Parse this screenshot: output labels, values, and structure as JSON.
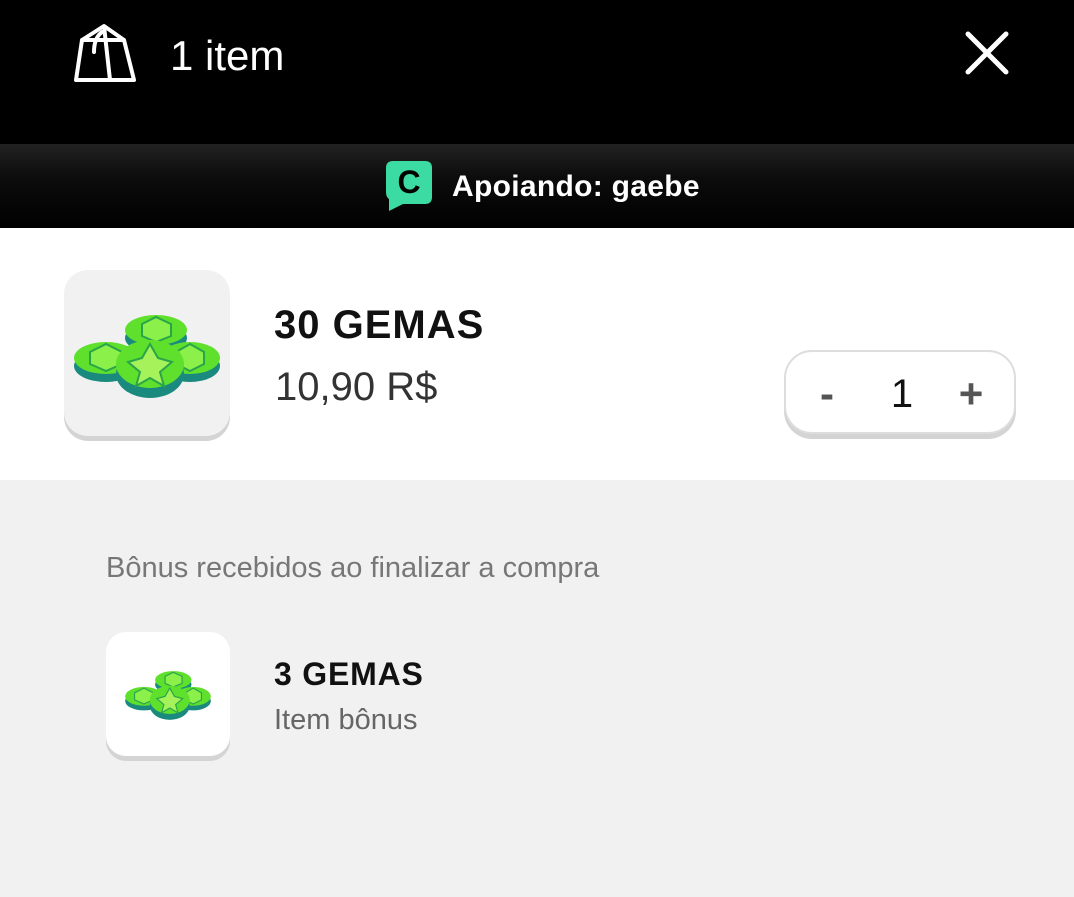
{
  "header": {
    "item_count": "1 item",
    "bag_icon": "shopping-bag-icon",
    "close_icon": "close-icon"
  },
  "support": {
    "text": "Apoiando: gaebe",
    "badge_letter": "C",
    "badge_color": "#3ddba4"
  },
  "product": {
    "name": "30 GEMAS",
    "price": "10,90 R$",
    "icon": "gems-icon",
    "quantity": "1",
    "minus_label": "-",
    "plus_label": "+"
  },
  "bonus": {
    "heading": "Bônus recebidos ao finalizar a compra",
    "item_name": "3 GEMAS",
    "item_label": "Item bônus",
    "icon": "gems-icon"
  },
  "colors": {
    "header_bg": "#000000",
    "accent_green": "#3ddba4",
    "gem_green": "#5fe02c",
    "gem_teal": "#1e9c8c"
  }
}
